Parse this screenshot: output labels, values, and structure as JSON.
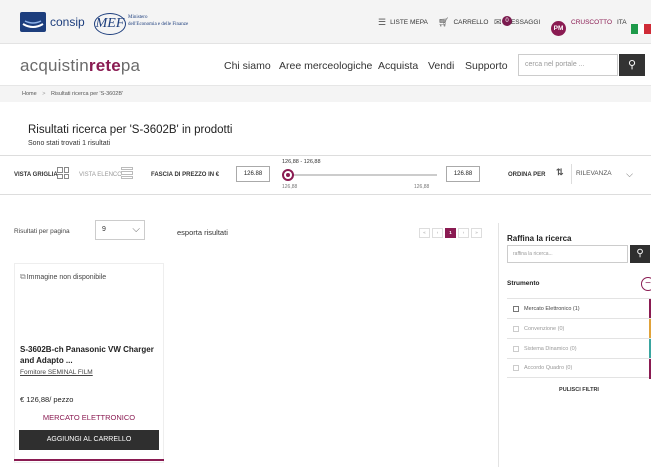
{
  "topbar": {
    "consip": "consip",
    "mef": "MEF",
    "mef_sub_1": "Ministero",
    "mef_sub_2": "dell'Economia e delle Finanze",
    "liste_mepa": "LISTE MEPA",
    "carrello": "CARRELLO",
    "messaggi": "MESSAGGI",
    "messaggi_count": "0",
    "avatar": "PM",
    "cruscotto": "CRUSCOTTO",
    "lang": "ITA",
    "flag_colors": [
      "#1e9a4a",
      "#ffffff",
      "#cf2b37"
    ]
  },
  "header": {
    "brand_1": "acquistin",
    "brand_2": "rete",
    "brand_3": "pa",
    "nav": [
      "Chi siamo",
      "Aree merceologiche",
      "Acquista",
      "Vendi",
      "Supporto"
    ],
    "search_placeholder": "cerca nel portale ..."
  },
  "breadcrumb": {
    "home": "Home",
    "sep": ">",
    "current": "Risultati ricerca per 'S-3602B'"
  },
  "results": {
    "title": "Risultati ricerca per 'S-3602B' in prodotti",
    "count": "Sono stati trovati 1 risultati"
  },
  "filters": {
    "vista_griglia": "VISTA GRIGLIA",
    "vista_elenco": "VISTA ELENCO",
    "fascia_prezzo": "FASCIA DI PREZZO IN €",
    "price_min": "126.88",
    "price_max": "126.88",
    "range_label": "126,88 - 126,88",
    "range_min": "126,88",
    "range_max": "126,88",
    "ordina_per": "ORDINA PER",
    "sort_value": "RILEVANZA"
  },
  "listing": {
    "per_page_label": "Risultati per pagina",
    "per_page_value": "9",
    "export": "esporta risultati",
    "pager": [
      "«",
      "‹",
      "1",
      "›",
      "»"
    ]
  },
  "product": {
    "image_alt": "Immagine non disponibile",
    "title": "S-3602B-ch Panasonic VW Charger and Adapto ...",
    "supplier": "Fornitore SEMINAL FILM",
    "price": "€ 126,88/ pezzo",
    "market": "MERCATO ELETTRONICO",
    "add_to_cart": "AGGIUNGI AL CARRELLO"
  },
  "sidebar": {
    "title": "Raffina la ricerca",
    "input_placeholder": "raffina la ricerca...",
    "section": "Strumento",
    "options": [
      {
        "label": "Mercato Elettronico (1)",
        "enabled": true,
        "color": "#8a1b52"
      },
      {
        "label": "Convenzione (0)",
        "enabled": false,
        "color": "#e0a23a"
      },
      {
        "label": "Sistema Dinamico (0)",
        "enabled": false,
        "color": "#3aa5a0"
      },
      {
        "label": "Accordo Quadro (0)",
        "enabled": false,
        "color": "#8a1b52"
      }
    ],
    "clear": "PULISCI FILTRI"
  }
}
